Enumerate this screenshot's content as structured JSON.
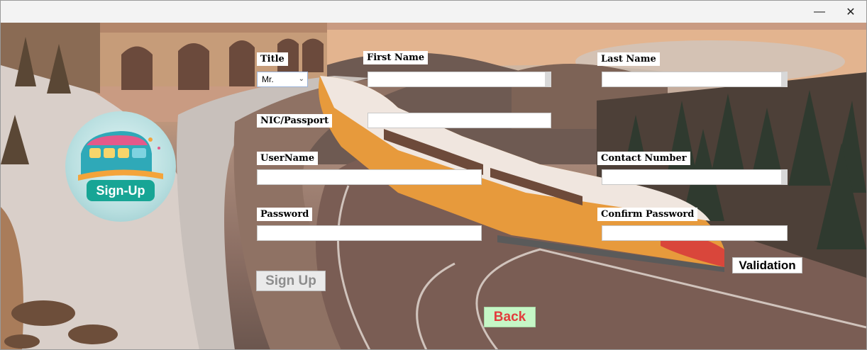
{
  "window": {
    "minimize_glyph": "—",
    "close_glyph": "✕"
  },
  "logo": {
    "text": "Sign-Up"
  },
  "form": {
    "title_label": "Title",
    "title_value": "Mr.",
    "first_name_label": "First Name",
    "last_name_label": "Last Name",
    "nic_label": "NIC/Passport",
    "username_label": "UserName",
    "contact_label": "Contact Number",
    "password_label": "Password",
    "confirm_password_label": "Confirm Password"
  },
  "buttons": {
    "signup": "Sign Up",
    "validation": "Validation",
    "back": "Back"
  },
  "colors": {
    "back_button_bg": "#c6f7c6",
    "back_button_text": "#e23d3d",
    "signup_disabled_text": "#8d8d8d",
    "logo_badge": "#17a595"
  }
}
